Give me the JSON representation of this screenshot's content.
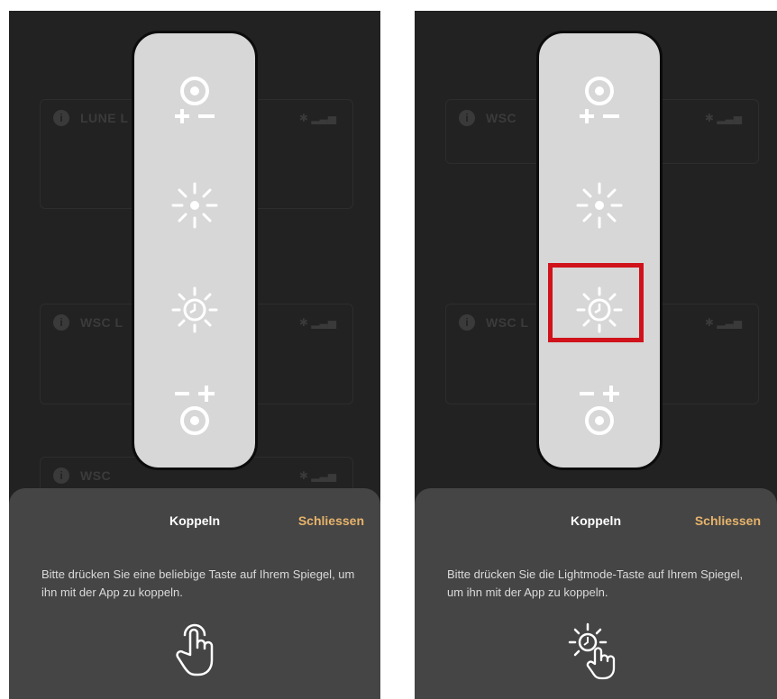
{
  "left": {
    "background_rows": [
      "LUNE L",
      "WSC L",
      "WSC"
    ],
    "sheet": {
      "title": "Koppeln",
      "close_label": "Schliessen",
      "message": "Bitte drücken Sie eine beliebige Taste auf Ihrem Spiegel, um ihn mit der App zu koppeln.",
      "hint_icon": "tap-hand-icon"
    }
  },
  "right": {
    "background_rows": [
      "WSC",
      "WSC L"
    ],
    "sheet": {
      "title": "Koppeln",
      "close_label": "Schliessen",
      "message": "Bitte drücken Sie die Lightmode-Taste auf Ihrem Spiegel, um ihn mit der App zu koppeln.",
      "hint_icon": "lightmode-tap-icon"
    },
    "highlighted_button": "lightmode-button"
  },
  "remote_buttons": [
    "dimmer-down-button",
    "brightness-button",
    "lightmode-button",
    "dimmer-up-button"
  ],
  "colors": {
    "accent": "#e7b36b",
    "highlight": "#d0121b",
    "sheet": "#454545",
    "remote": "#d7d7d7"
  }
}
